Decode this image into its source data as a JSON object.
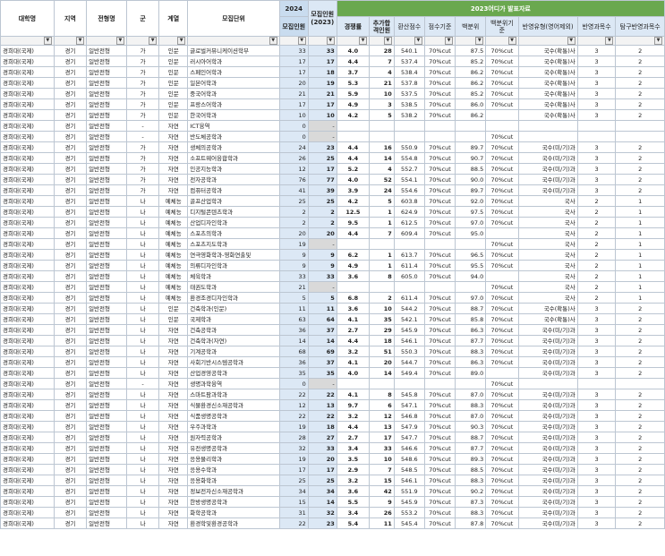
{
  "headers": {
    "univ": "대학명",
    "region": "지역",
    "track": "전형명",
    "group": "군",
    "field": "계열",
    "unit": "모집단위",
    "y2024_top": "2024",
    "y2024_sub": "모집인원",
    "quota2023": "모집인원\n(2023)",
    "adiga": "2023어디가 발표자료",
    "comp": "경쟁률",
    "extra": "추가합격인원",
    "conv": "환산점수",
    "basis": "점수기준",
    "pct": "백분위",
    "pct_basis": "백분위기준",
    "reflect": "반영유형(영어제외)",
    "reflect_n": "반영과목수",
    "inq_n": "탐구반영과목수"
  },
  "rows": [
    [
      "경희대(국제)",
      "경기",
      "일반전형",
      "가",
      "인문",
      "글로벌커뮤니케이션학부",
      "33",
      "33",
      "4.0",
      "28",
      "540.1",
      "70%cut",
      "87.5",
      "70%cut",
      "국수(확통)사",
      "3",
      "2"
    ],
    [
      "경희대(국제)",
      "경기",
      "일반전형",
      "가",
      "인문",
      "러시아어학과",
      "17",
      "17",
      "4.4",
      "7",
      "537.4",
      "70%cut",
      "85.2",
      "70%cut",
      "국수(확통)사",
      "3",
      "2"
    ],
    [
      "경희대(국제)",
      "경기",
      "일반전형",
      "가",
      "인문",
      "스페인어학과",
      "17",
      "18",
      "3.7",
      "4",
      "538.4",
      "70%cut",
      "86.2",
      "70%cut",
      "국수(확통)사",
      "3",
      "2"
    ],
    [
      "경희대(국제)",
      "경기",
      "일반전형",
      "가",
      "인문",
      "일본어학과",
      "20",
      "19",
      "5.3",
      "21",
      "537.8",
      "70%cut",
      "86.2",
      "70%cut",
      "국수(확통)사",
      "3",
      "2"
    ],
    [
      "경희대(국제)",
      "경기",
      "일반전형",
      "가",
      "인문",
      "중국어학과",
      "21",
      "21",
      "5.9",
      "10",
      "537.5",
      "70%cut",
      "85.2",
      "70%cut",
      "국수(확통)사",
      "3",
      "2"
    ],
    [
      "경희대(국제)",
      "경기",
      "일반전형",
      "가",
      "인문",
      "프랑스어학과",
      "17",
      "17",
      "4.9",
      "3",
      "538.5",
      "70%cut",
      "86.0",
      "70%cut",
      "국수(확통)사",
      "3",
      "2"
    ],
    [
      "경희대(국제)",
      "경기",
      "일반전형",
      "가",
      "인문",
      "한국어학과",
      "10",
      "10",
      "4.2",
      "5",
      "538.2",
      "70%cut",
      "86.2",
      "",
      "국수(확통)사",
      "3",
      "2"
    ],
    [
      "경희대(국제)",
      "경기",
      "일반전형",
      "-",
      "자연",
      "ICT융역",
      "0",
      "-",
      "",
      "",
      "",
      "",
      "",
      "",
      "",
      "",
      ""
    ],
    [
      "경희대(국제)",
      "경기",
      "일반전형",
      "-",
      "자연",
      "반도체공학과",
      "0",
      "-",
      "",
      "",
      "",
      "",
      "",
      "70%cut",
      "",
      "",
      ""
    ],
    [
      "경희대(국제)",
      "경기",
      "일반전형",
      "가",
      "자연",
      "생체의공학과",
      "24",
      "23",
      "4.4",
      "16",
      "550.9",
      "70%cut",
      "89.7",
      "70%cut",
      "국수(미/기)과",
      "3",
      "2"
    ],
    [
      "경희대(국제)",
      "경기",
      "일반전형",
      "가",
      "자연",
      "소프트웨어융합학과",
      "26",
      "25",
      "4.4",
      "14",
      "554.8",
      "70%cut",
      "90.7",
      "70%cut",
      "국수(미/기)과",
      "3",
      "2"
    ],
    [
      "경희대(국제)",
      "경기",
      "일반전형",
      "가",
      "자연",
      "인공지능학과",
      "12",
      "17",
      "5.2",
      "4",
      "552.7",
      "70%cut",
      "88.5",
      "70%cut",
      "국수(미/기)과",
      "3",
      "2"
    ],
    [
      "경희대(국제)",
      "경기",
      "일반전형",
      "가",
      "자연",
      "전자공학과",
      "76",
      "77",
      "4.0",
      "52",
      "554.1",
      "70%cut",
      "90.0",
      "70%cut",
      "국수(미/기)과",
      "3",
      "2"
    ],
    [
      "경희대(국제)",
      "경기",
      "일반전형",
      "가",
      "자연",
      "컴퓨터공학과",
      "41",
      "39",
      "3.9",
      "24",
      "554.6",
      "70%cut",
      "89.7",
      "70%cut",
      "국수(미/기)과",
      "3",
      "2"
    ],
    [
      "경희대(국제)",
      "경기",
      "일반전형",
      "나",
      "예체능",
      "골프산업학과",
      "25",
      "25",
      "4.2",
      "5",
      "603.8",
      "70%cut",
      "92.0",
      "70%cut",
      "국사",
      "2",
      "1"
    ],
    [
      "경희대(국제)",
      "경기",
      "일반전형",
      "나",
      "예체능",
      "디지털콘텐츠학과",
      "2",
      "2",
      "12.5",
      "1",
      "624.9",
      "70%cut",
      "97.5",
      "70%cut",
      "국사",
      "2",
      "1"
    ],
    [
      "경희대(국제)",
      "경기",
      "일반전형",
      "나",
      "예체능",
      "산업디자인학과",
      "2",
      "2",
      "9.5",
      "1",
      "612.5",
      "70%cut",
      "97.0",
      "70%cut",
      "국사",
      "2",
      "1"
    ],
    [
      "경희대(국제)",
      "경기",
      "일반전형",
      "나",
      "예체능",
      "스포츠의학과",
      "20",
      "20",
      "4.4",
      "7",
      "609.4",
      "70%cut",
      "95.0",
      "",
      "국사",
      "2",
      "1"
    ],
    [
      "경희대(국제)",
      "경기",
      "일반전형",
      "나",
      "예체능",
      "스포츠지도학과",
      "19",
      "-",
      "",
      "",
      "",
      "",
      "",
      "70%cut",
      "국사",
      "2",
      "1"
    ],
    [
      "경희대(국제)",
      "경기",
      "일반전형",
      "나",
      "예체능",
      "연극영화학과-영화연출및",
      "9",
      "9",
      "6.2",
      "1",
      "613.7",
      "70%cut",
      "96.5",
      "70%cut",
      "국사",
      "2",
      "1"
    ],
    [
      "경희대(국제)",
      "경기",
      "일반전형",
      "나",
      "예체능",
      "의류디자인학과",
      "9",
      "9",
      "4.9",
      "1",
      "611.4",
      "70%cut",
      "95.5",
      "70%cut",
      "국사",
      "2",
      "1"
    ],
    [
      "경희대(국제)",
      "경기",
      "일반전형",
      "나",
      "예체능",
      "체육학과",
      "33",
      "33",
      "3.6",
      "8",
      "605.0",
      "70%cut",
      "94.0",
      "",
      "국사",
      "2",
      "1"
    ],
    [
      "경희대(국제)",
      "경기",
      "일반전형",
      "나",
      "예체능",
      "태권도학과",
      "21",
      "-",
      "",
      "",
      "",
      "",
      "",
      "70%cut",
      "국사",
      "2",
      "1"
    ],
    [
      "경희대(국제)",
      "경기",
      "일반전형",
      "나",
      "예체능",
      "환경조경디자인학과",
      "5",
      "5",
      "6.8",
      "2",
      "611.4",
      "70%cut",
      "97.0",
      "70%cut",
      "국사",
      "2",
      "1"
    ],
    [
      "경희대(국제)",
      "경기",
      "일반전형",
      "나",
      "인문",
      "건축학과(인문)",
      "11",
      "11",
      "3.6",
      "10",
      "544.2",
      "70%cut",
      "88.7",
      "70%cut",
      "국수(확통)사",
      "3",
      "2"
    ],
    [
      "경희대(국제)",
      "경기",
      "일반전형",
      "나",
      "인문",
      "국제학과",
      "63",
      "64",
      "4.1",
      "35",
      "542.1",
      "70%cut",
      "85.8",
      "70%cut",
      "국수(확통)사",
      "3",
      "2"
    ],
    [
      "경희대(국제)",
      "경기",
      "일반전형",
      "나",
      "자연",
      "건축공학과",
      "36",
      "37",
      "2.7",
      "29",
      "545.9",
      "70%cut",
      "86.3",
      "70%cut",
      "국수(미/기)과",
      "3",
      "2"
    ],
    [
      "경희대(국제)",
      "경기",
      "일반전형",
      "나",
      "자연",
      "건축학과(자연)",
      "14",
      "14",
      "4.4",
      "18",
      "546.1",
      "70%cut",
      "87.7",
      "70%cut",
      "국수(미/기)과",
      "3",
      "2"
    ],
    [
      "경희대(국제)",
      "경기",
      "일반전형",
      "나",
      "자연",
      "기계공학과",
      "68",
      "69",
      "3.2",
      "51",
      "550.3",
      "70%cut",
      "88.3",
      "70%cut",
      "국수(미/기)과",
      "3",
      "2"
    ],
    [
      "경희대(국제)",
      "경기",
      "일반전형",
      "나",
      "자연",
      "사회기반시스템공학과",
      "36",
      "37",
      "4.1",
      "20",
      "544.7",
      "70%cut",
      "86.3",
      "70%cut",
      "국수(미/기)과",
      "3",
      "2"
    ],
    [
      "경희대(국제)",
      "경기",
      "일반전형",
      "나",
      "자연",
      "산업경영공학과",
      "35",
      "35",
      "4.0",
      "14",
      "549.4",
      "70%cut",
      "89.0",
      "",
      "국수(미/기)과",
      "3",
      "2"
    ],
    [
      "경희대(국제)",
      "경기",
      "일반전형",
      "-",
      "자연",
      "생명과학융역",
      "0",
      "-",
      "",
      "",
      "",
      "",
      "",
      "70%cut",
      "",
      "",
      ""
    ],
    [
      "경희대(국제)",
      "경기",
      "일반전형",
      "나",
      "자연",
      "스마트팜과학과",
      "22",
      "22",
      "4.1",
      "8",
      "545.8",
      "70%cut",
      "87.0",
      "70%cut",
      "국수(미/기)과",
      "3",
      "2"
    ],
    [
      "경희대(국제)",
      "경기",
      "일반전형",
      "나",
      "자연",
      "식물환경신소재공학과",
      "12",
      "13",
      "9.7",
      "6",
      "547.1",
      "70%cut",
      "88.3",
      "70%cut",
      "국수(미/기)과",
      "3",
      "2"
    ],
    [
      "경희대(국제)",
      "경기",
      "일반전형",
      "나",
      "자연",
      "식품생명공학과",
      "22",
      "22",
      "3.2",
      "12",
      "546.8",
      "70%cut",
      "87.0",
      "70%cut",
      "국수(미/기)과",
      "3",
      "2"
    ],
    [
      "경희대(국제)",
      "경기",
      "일반전형",
      "나",
      "자연",
      "우주과학과",
      "19",
      "18",
      "4.4",
      "13",
      "547.9",
      "70%cut",
      "90.3",
      "70%cut",
      "국수(미/기)과",
      "3",
      "2"
    ],
    [
      "경희대(국제)",
      "경기",
      "일반전형",
      "나",
      "자연",
      "원자력공학과",
      "28",
      "27",
      "2.7",
      "17",
      "547.7",
      "70%cut",
      "88.7",
      "70%cut",
      "국수(미/기)과",
      "3",
      "2"
    ],
    [
      "경희대(국제)",
      "경기",
      "일반전형",
      "나",
      "자연",
      "유전생명공학과",
      "32",
      "33",
      "3.4",
      "33",
      "546.6",
      "70%cut",
      "87.7",
      "70%cut",
      "국수(미/기)과",
      "3",
      "2"
    ],
    [
      "경희대(국제)",
      "경기",
      "일반전형",
      "나",
      "자연",
      "응용물리학과",
      "19",
      "20",
      "3.5",
      "10",
      "548.6",
      "70%cut",
      "89.3",
      "70%cut",
      "국수(미/기)과",
      "3",
      "2"
    ],
    [
      "경희대(국제)",
      "경기",
      "일반전형",
      "나",
      "자연",
      "응용수학과",
      "17",
      "17",
      "2.9",
      "7",
      "548.5",
      "70%cut",
      "88.5",
      "70%cut",
      "국수(미/기)과",
      "3",
      "2"
    ],
    [
      "경희대(국제)",
      "경기",
      "일반전형",
      "나",
      "자연",
      "응용화학과",
      "25",
      "25",
      "3.2",
      "15",
      "546.1",
      "70%cut",
      "88.3",
      "70%cut",
      "국수(미/기)과",
      "3",
      "2"
    ],
    [
      "경희대(국제)",
      "경기",
      "일반전형",
      "나",
      "자연",
      "정보전자신소재공학과",
      "34",
      "34",
      "3.6",
      "42",
      "551.9",
      "70%cut",
      "90.2",
      "70%cut",
      "국수(미/기)과",
      "3",
      "2"
    ],
    [
      "경희대(국제)",
      "경기",
      "일반전형",
      "나",
      "자연",
      "한방생명공학과",
      "15",
      "14",
      "5.5",
      "9",
      "545.9",
      "70%cut",
      "87.3",
      "70%cut",
      "국수(미/기)과",
      "3",
      "2"
    ],
    [
      "경희대(국제)",
      "경기",
      "일반전형",
      "나",
      "자연",
      "화학공학과",
      "31",
      "32",
      "3.4",
      "26",
      "553.2",
      "70%cut",
      "88.3",
      "70%cut",
      "국수(미/기)과",
      "3",
      "2"
    ],
    [
      "경희대(국제)",
      "경기",
      "일반전형",
      "나",
      "자연",
      "환경학및환경공학과",
      "22",
      "23",
      "5.4",
      "11",
      "545.4",
      "70%cut",
      "87.8",
      "70%cut",
      "국수(미/기)과",
      "3",
      "2"
    ]
  ]
}
